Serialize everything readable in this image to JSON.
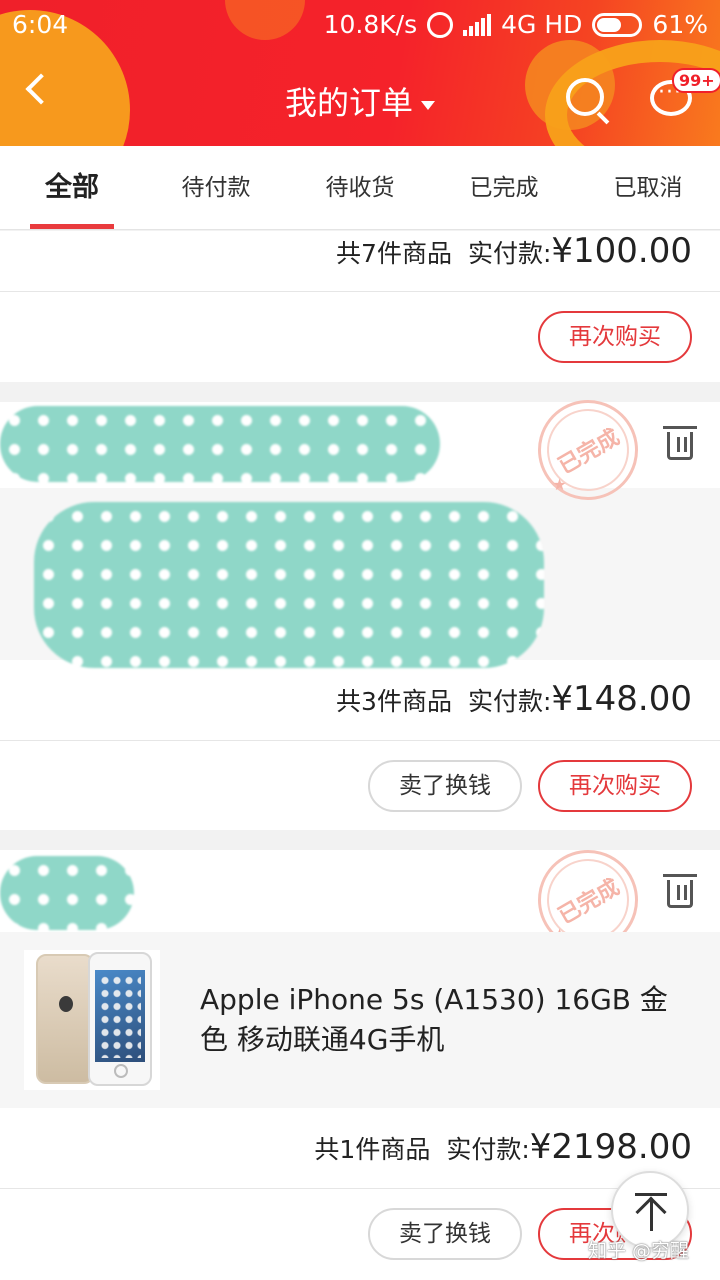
{
  "status_bar": {
    "time": "6:04",
    "net_speed": "10.8K/s",
    "network": "4G HD",
    "battery": "61%"
  },
  "header": {
    "title": "我的订单",
    "message_badge": "99+"
  },
  "tabs": [
    {
      "label": "全部",
      "active": true
    },
    {
      "label": "待付款",
      "active": false
    },
    {
      "label": "待收货",
      "active": false
    },
    {
      "label": "已完成",
      "active": false
    },
    {
      "label": "已取消",
      "active": false
    }
  ],
  "orders": [
    {
      "count": "共7件商品",
      "paid_label": "实付款:",
      "amount": "¥100.00",
      "buttons": [
        "再次购买"
      ]
    },
    {
      "status_stamp": "已完成",
      "count": "共3件商品",
      "paid_label": "实付款:",
      "amount": "¥148.00",
      "buttons": [
        "卖了换钱",
        "再次购买"
      ]
    },
    {
      "status_stamp": "已完成",
      "product_title": "Apple iPhone 5s (A1530) 16GB 金色 移动联通4G手机",
      "count": "共1件商品",
      "paid_label": "实付款:",
      "amount": "¥2198.00",
      "buttons": [
        "卖了换钱",
        "再次购买"
      ]
    }
  ],
  "watermark": "知乎 @穷醒",
  "colors": {
    "header_red": "#f0202a",
    "accent": "#e4393c",
    "censor_teal": "#8fd7c8"
  }
}
